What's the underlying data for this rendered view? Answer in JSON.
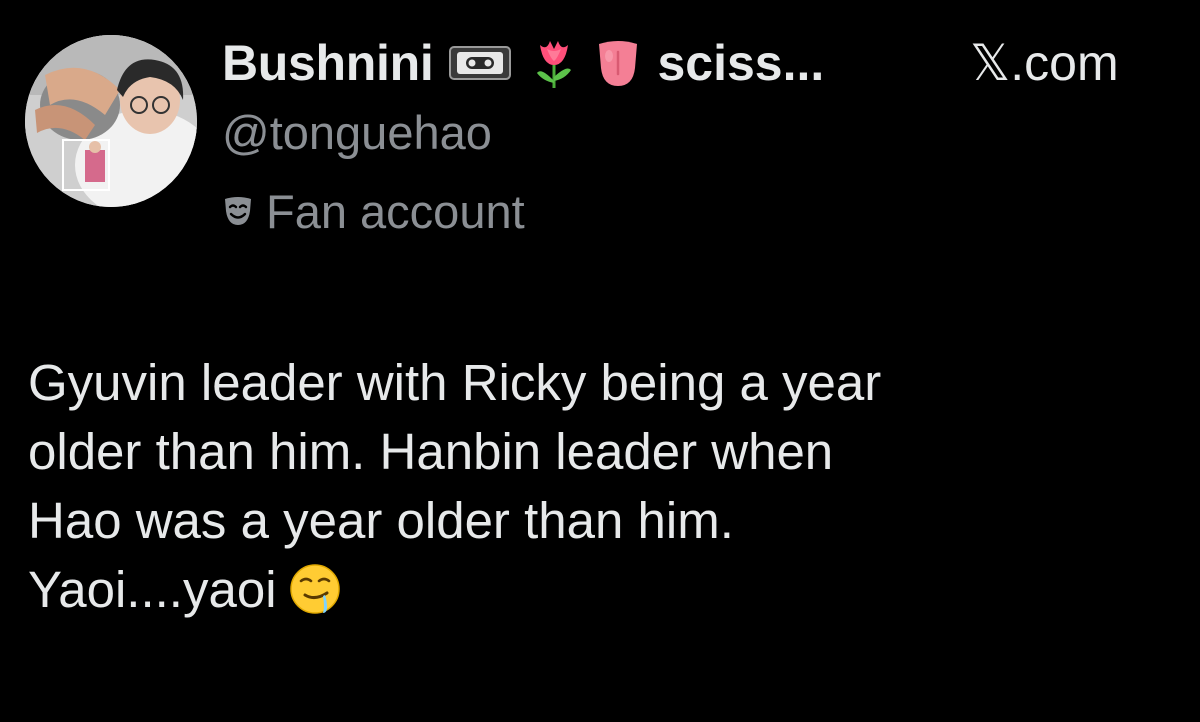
{
  "profile": {
    "display_name": "Bushnini",
    "name_suffix": "sciss...",
    "name_icons": [
      "videocassette-icon",
      "tulip-icon",
      "tongue-icon"
    ],
    "handle": "@tonguehao",
    "badge_icon": "performing-arts-mask-icon",
    "badge_label": "Fan account",
    "avatar": "profile-photo"
  },
  "site": {
    "label": "𝕏.com"
  },
  "tweet": {
    "lines": [
      "Gyuvin leader with Ricky being a year",
      "older than him. Hanbin leader when",
      "Hao was a year older than him.",
      "Yaoi....yaoi"
    ],
    "trailing_emoji": "drooling-face-icon"
  },
  "colors": {
    "background": "#000000",
    "primary_text": "#e7e9ea",
    "secondary_text": "#8b8f94"
  }
}
